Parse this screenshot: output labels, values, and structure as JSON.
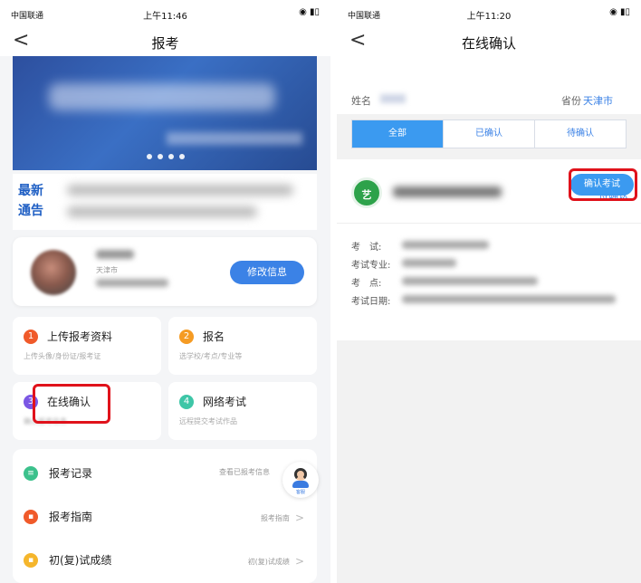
{
  "left": {
    "status_bar": {
      "carrier": "中国联通",
      "time": "上午11:46",
      "battery": "◉ ▮▯"
    },
    "nav": {
      "back": "<",
      "title": "报考"
    },
    "news": {
      "tag": "最新\n通告"
    },
    "profile": {
      "city": "天津市",
      "edit_button": "修改信息"
    },
    "grid": [
      {
        "num": "1",
        "label": "上传报考资料",
        "desc": "上传头像/身份证/报考证",
        "color": "#f05a2a"
      },
      {
        "num": "2",
        "label": "报名",
        "desc": "选学校/考点/专业等",
        "color": "#f59b23"
      },
      {
        "num": "3",
        "label": "在线确认",
        "desc": "确认报考信息",
        "color": "#7b57e4"
      },
      {
        "num": "4",
        "label": "网络考试",
        "desc": "远程提交考试作品",
        "color": "#3ec6a7"
      }
    ],
    "list": [
      {
        "label": "报考记录",
        "right": "查看已报考信息",
        "color": "#3cc18c",
        "icon": "≡"
      },
      {
        "label": "报考指南",
        "right": "报考指南",
        "color": "#f05a2a",
        "icon": "▪"
      },
      {
        "label": "初(复)试成绩",
        "right": "初(复)试成绩",
        "color": "#f5b62c",
        "icon": "▪"
      }
    ],
    "support_label": "客服"
  },
  "right": {
    "status_bar": {
      "carrier": "中国联通",
      "time": "上午11:20",
      "battery": "◉ ▮▯"
    },
    "nav": {
      "back": "<",
      "title": "在线确认"
    },
    "info": {
      "name_label": "姓名",
      "province_label": "省份",
      "province_value": "天津市"
    },
    "tabs": [
      "全部",
      "已确认",
      "待确认"
    ],
    "card": {
      "logo_text": "艺",
      "status": "待确认",
      "fields": [
        "考　试:",
        "考试专业:",
        "考　点:",
        "考试日期:"
      ],
      "confirm_button": "确认考试"
    }
  },
  "colors": {
    "accent": "#3b82e6",
    "highlight": "#e0121b"
  }
}
